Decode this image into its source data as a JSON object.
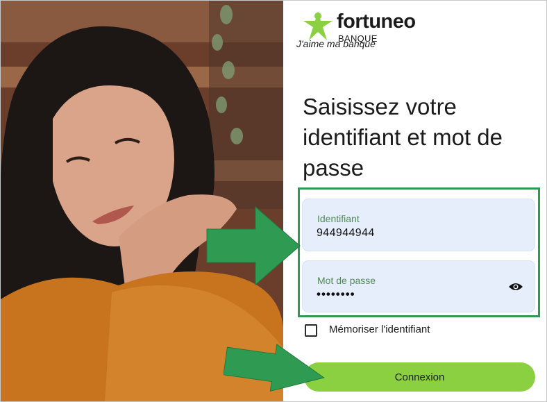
{
  "brand": {
    "name": "fortuneo",
    "sub": "BANQUE",
    "tagline": "J'aime ma banque",
    "accent_color": "#8bd041",
    "logo_icon": "star-person-icon"
  },
  "login": {
    "heading": "Saisissez votre identifiant et mot de passe",
    "identifier": {
      "label": "Identifiant",
      "value": "944944944"
    },
    "password": {
      "label": "Mot de passe",
      "value": "••••••••",
      "toggle_icon": "eye-icon"
    },
    "remember": {
      "label": "Mémoriser l'identifiant",
      "checked": false
    },
    "submit_label": "Connexion"
  },
  "annotations": {
    "highlight_color": "#2e9a52",
    "arrow_color": "#2e9a52"
  }
}
